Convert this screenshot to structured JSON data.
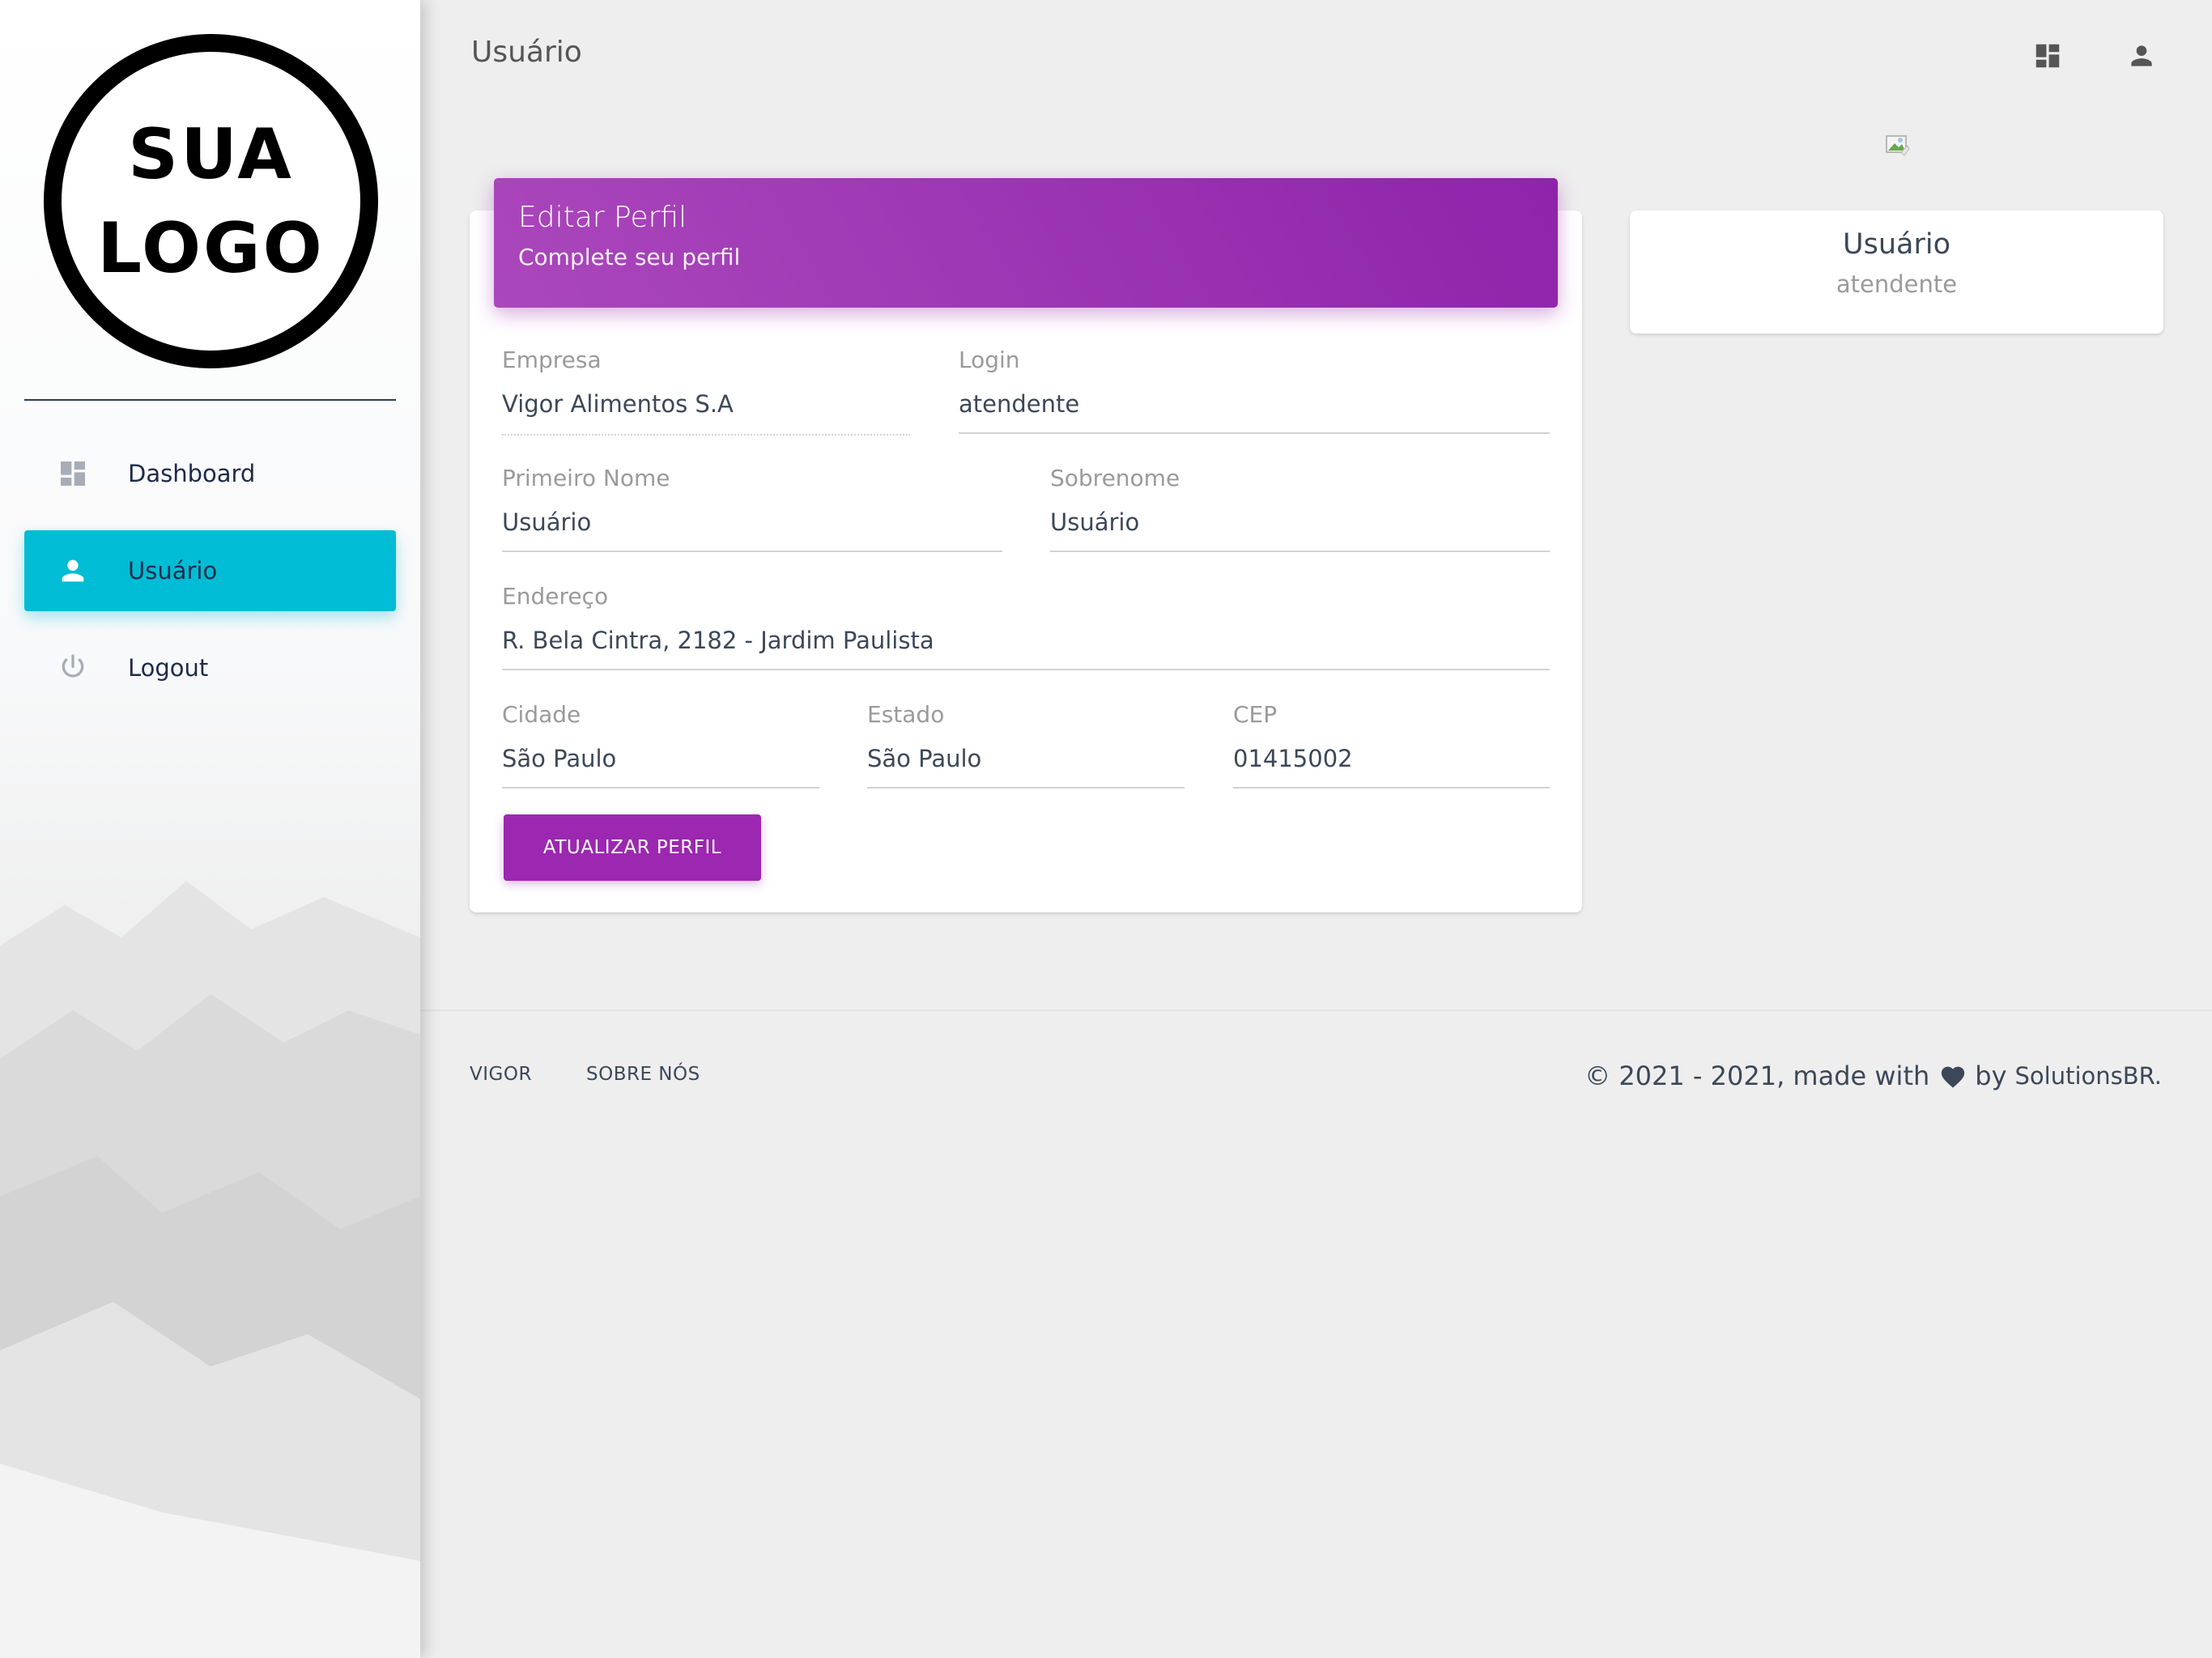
{
  "sidebar": {
    "logo": {
      "line1": "SUA",
      "line2": "LOGO"
    },
    "items": [
      {
        "label": "Dashboard",
        "icon": "dashboard-icon",
        "active": false
      },
      {
        "label": "Usuário",
        "icon": "person-icon",
        "active": true
      },
      {
        "label": "Logout",
        "icon": "power-icon",
        "active": false
      }
    ]
  },
  "header": {
    "title": "Usuário",
    "icons": [
      "dashboard-icon",
      "person-icon"
    ]
  },
  "profile_form": {
    "title": "Editar Perfil",
    "subtitle": "Complete seu perfil",
    "fields": {
      "empresa": {
        "label": "Empresa",
        "value": "Vigor Alimentos S.A"
      },
      "login": {
        "label": "Login",
        "value": "atendente"
      },
      "primeiro_nome": {
        "label": "Primeiro Nome",
        "value": "Usuário"
      },
      "sobrenome": {
        "label": "Sobrenome",
        "value": "Usuário"
      },
      "endereco": {
        "label": "Endereço",
        "value": "R. Bela Cintra, 2182 - Jardim Paulista"
      },
      "cidade": {
        "label": "Cidade",
        "value": "São Paulo"
      },
      "estado": {
        "label": "Estado",
        "value": "São Paulo"
      },
      "cep": {
        "label": "CEP",
        "value": "01415002"
      }
    },
    "submit_label": "ATUALIZAR PERFIL"
  },
  "user_card": {
    "name": "Usuário",
    "role": "atendente"
  },
  "footer": {
    "links": [
      "VIGOR",
      "SOBRE NÓS"
    ],
    "copyright_text": "© 2021 - 2021, made with",
    "by_text": "by",
    "brand": "SolutionsBR."
  },
  "colors": {
    "accent_purple": "#9c27b0",
    "active_cyan": "#00bcd4"
  }
}
